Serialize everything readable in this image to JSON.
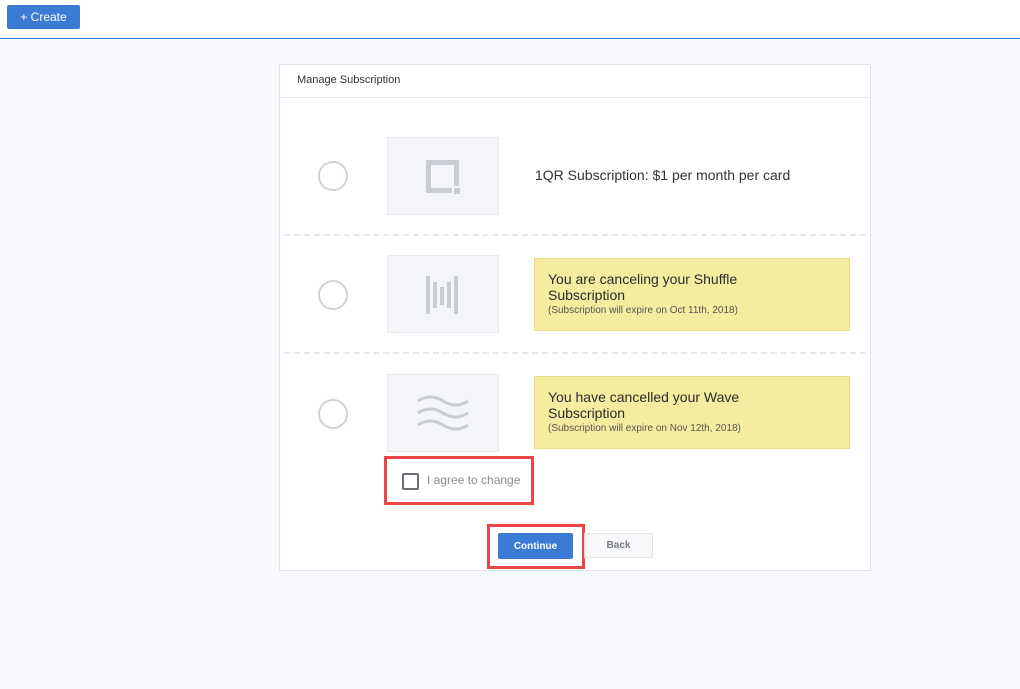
{
  "toolbar": {
    "create_label": "+ Create"
  },
  "card": {
    "title": "Manage Subscription"
  },
  "options": [
    {
      "icon": "qr-square-icon",
      "label": "1QR Subscription: $1 per month per card"
    },
    {
      "icon": "shuffle-bars-icon",
      "notice_title": "You are canceling your Shuffle Subscription",
      "notice_sub": "(Subscription will expire on Oct 11th, 2018)"
    },
    {
      "icon": "wave-icon",
      "notice_title": "You have cancelled your Wave Subscription",
      "notice_sub": "(Subscription will expire on Nov 12th, 2018)"
    }
  ],
  "agree": {
    "label": "I agree to change",
    "checked": false
  },
  "actions": {
    "continue_label": "Continue",
    "back_label": "Back"
  },
  "colors": {
    "accent": "#3a7bd5",
    "notice_bg": "#f5ec9f",
    "highlight": "#ec4545"
  }
}
